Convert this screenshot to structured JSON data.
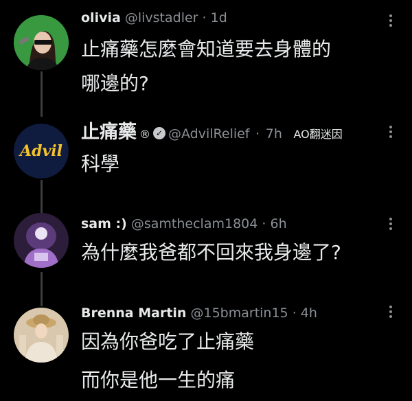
{
  "tweets": [
    {
      "name": "olivia",
      "handle": "@livstadler",
      "time": "1d",
      "lines": [
        "止痛藥怎麼會知道要去身體的",
        "哪邊的?"
      ]
    },
    {
      "name": "止痛藥",
      "reg_mark": "®",
      "verified_mark": "✓",
      "handle": "@AdvilRelief",
      "time": "7h",
      "tag": "AO翻迷因",
      "logo_text": "Advil",
      "lines": [
        "科學"
      ]
    },
    {
      "name": "sam :)",
      "handle": "@samtheclam1804",
      "time": "6h",
      "lines": [
        "為什麼我爸都不回來我身邊了?"
      ]
    },
    {
      "name": "Brenna Martin",
      "handle": "@15bmartin15",
      "time": "4h",
      "lines": [
        "因為你爸吃了止痛藥",
        "而你是他一生的痛"
      ]
    }
  ],
  "separator": "·",
  "colors": {
    "background": "#000000",
    "text": "#e7e9ea",
    "muted": "#8b8f94",
    "advil_navy": "#0f1c3f",
    "advil_gold": "#f4c22b"
  }
}
